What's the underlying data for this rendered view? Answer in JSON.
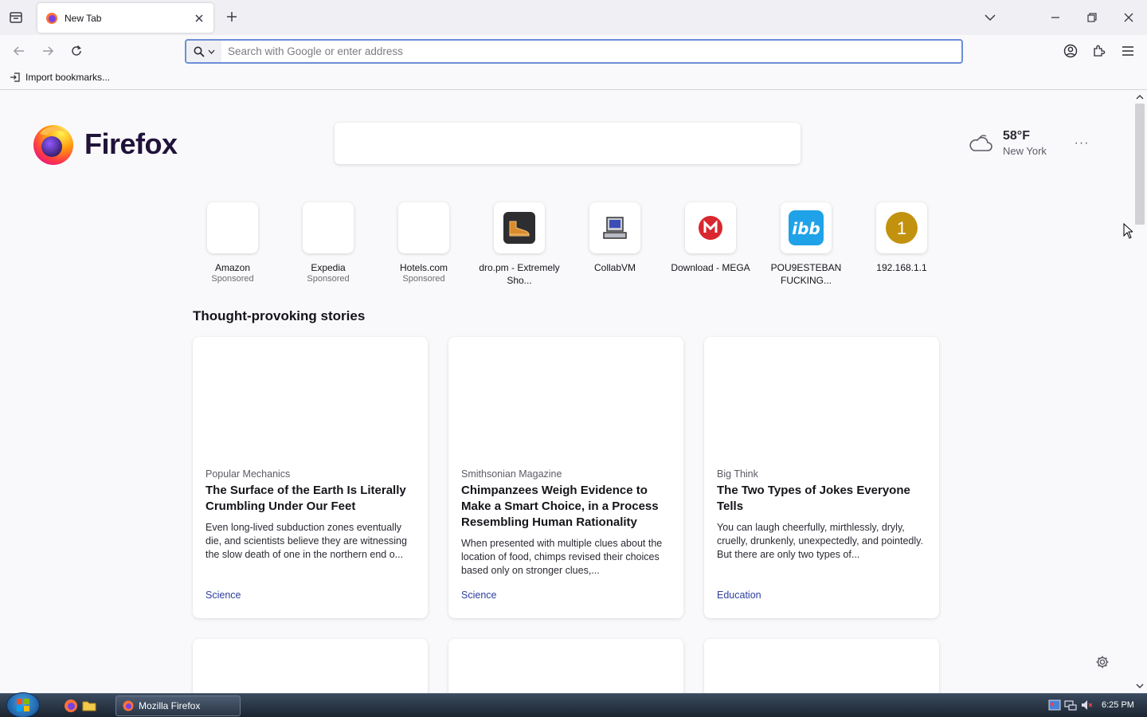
{
  "browser": {
    "tab_title": "New Tab",
    "address_placeholder": "Search with Google or enter address",
    "import_bookmarks_label": "Import bookmarks..."
  },
  "home": {
    "wordmark": "Firefox",
    "weather": {
      "temperature": "58°F",
      "city": "New York",
      "icon": "cloudy-icon"
    },
    "weather_menu": "···"
  },
  "top_sites": [
    {
      "label": "Amazon",
      "sponsor": "Sponsored",
      "icon": "blank"
    },
    {
      "label": "Expedia",
      "sponsor": "Sponsored",
      "icon": "blank"
    },
    {
      "label": "Hotels.com",
      "sponsor": "Sponsored",
      "icon": "blank"
    },
    {
      "label": "dro.pm - Extremely Sho...",
      "sponsor": "",
      "icon": "shoe-icon"
    },
    {
      "label": "CollabVM",
      "sponsor": "",
      "icon": "computer-icon"
    },
    {
      "label": "Download - MEGA",
      "sponsor": "",
      "icon": "mega-icon",
      "color": "#d9272e"
    },
    {
      "label": "POU9ESTEBAN FUCKING...",
      "sponsor": "",
      "icon": "ibb-icon",
      "color": "#1fa2e8"
    },
    {
      "label": "192.168.1.1",
      "sponsor": "",
      "icon": "letter-1-icon",
      "letter": "1",
      "color": "#c2920f"
    }
  ],
  "stories": {
    "section_title": "Thought-provoking stories",
    "cards": [
      {
        "source": "Popular Mechanics",
        "title": "The Surface of the Earth Is Literally Crumbling Under Our Feet",
        "description": "Even long-lived subduction zones eventually die, and scientists believe they are witnessing the slow death of one in the northern end o...",
        "topic": "Science"
      },
      {
        "source": "Smithsonian Magazine",
        "title": "Chimpanzees Weigh Evidence to Make a Smart Choice, in a Process Resembling Human Rationality",
        "description": "When presented with multiple clues about the location of food, chimps revised their choices based only on stronger clues,...",
        "topic": "Science"
      },
      {
        "source": "Big Think",
        "title": "The Two Types of Jokes Everyone Tells",
        "description": "You can laugh cheerfully, mirthlessly, dryly, cruelly, drunkenly, unexpectedly, and pointedly. But there are only two types of...",
        "topic": "Education"
      }
    ]
  },
  "taskbar": {
    "task_label": "Mozilla Firefox",
    "clock": "6:25 PM"
  },
  "colors": {
    "accent": "#6b8ed6",
    "topic_link": "#2c3e9e"
  }
}
